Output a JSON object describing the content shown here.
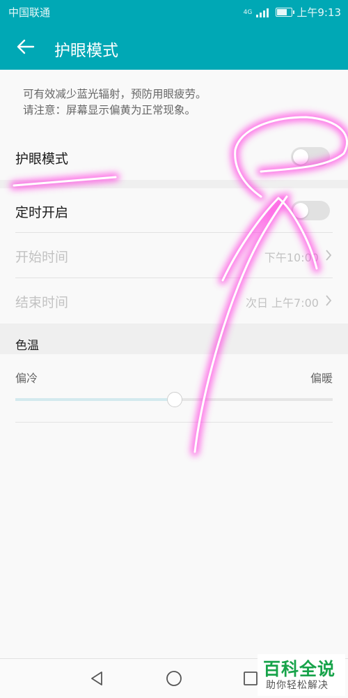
{
  "status_bar": {
    "carrier": "中国联通",
    "network": "4G",
    "time": "上午9:13",
    "battery_level": 0.7,
    "icons": [
      "signal-icon",
      "battery-icon"
    ]
  },
  "header": {
    "title": "护眼模式",
    "back_icon": "back-arrow-icon",
    "background_color": "#00a8b5"
  },
  "description": {
    "line1": "可有效减少蓝光辐射，预防用眼疲劳。",
    "line2": "请注意：屏幕显示偏黄为正常现象。"
  },
  "settings": {
    "eye_comfort": {
      "label": "护眼模式",
      "enabled": false
    },
    "scheduled": {
      "label": "定时开启",
      "enabled": false
    },
    "start_time": {
      "label": "开始时间",
      "value": "下午10:00"
    },
    "end_time": {
      "label": "结束时间",
      "value": "次日 上午7:00"
    }
  },
  "color_temperature": {
    "title": "色温",
    "cool_label": "偏冷",
    "warm_label": "偏暖",
    "level": 0.5
  },
  "nav_bar": {
    "icons": [
      "back-triangle-icon",
      "home-circle-icon",
      "recents-square-icon"
    ]
  },
  "watermark": {
    "title": "百科全说",
    "subtitle": "助你轻松解决"
  },
  "colors": {
    "accent": "#00a8b5",
    "annotation": "#ff40e0",
    "watermark_green": "#17a34a"
  }
}
